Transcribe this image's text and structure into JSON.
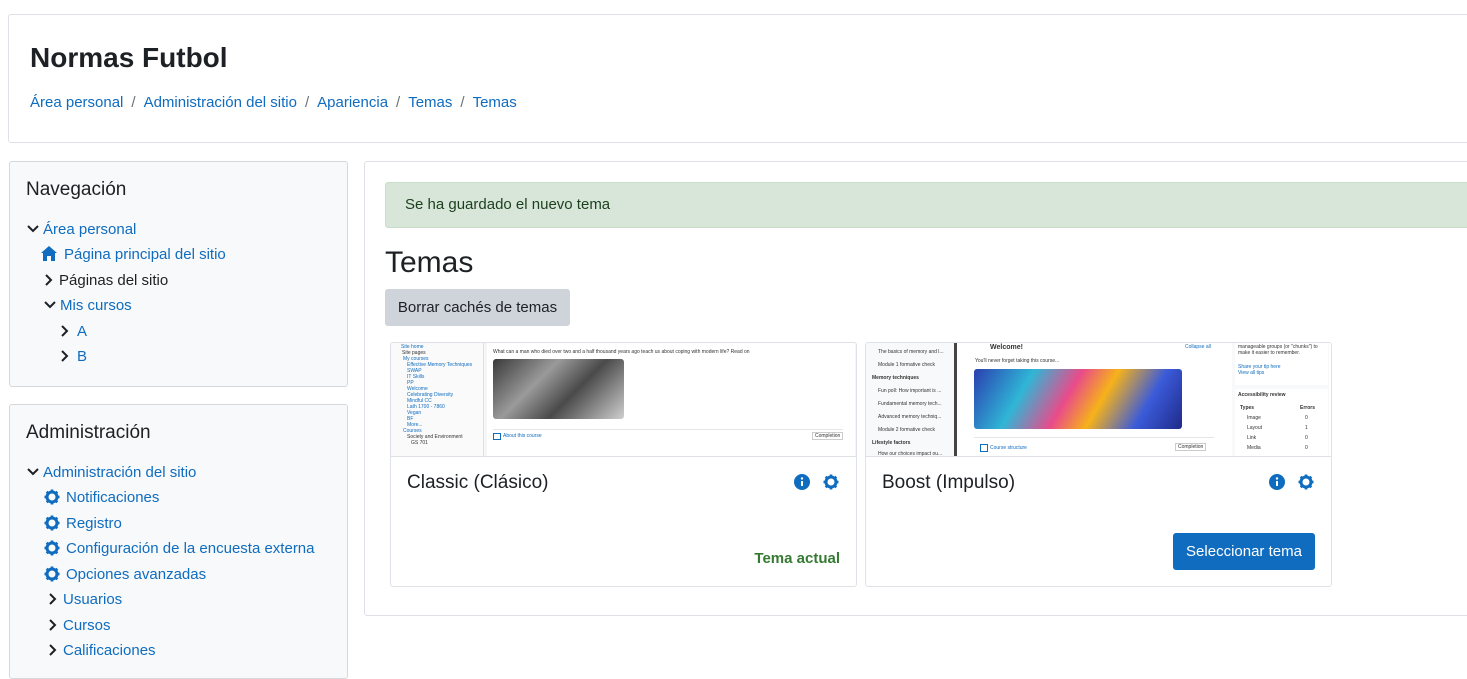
{
  "header": {
    "site_title": "Normas Futbol",
    "breadcrumb": [
      "Área personal",
      "Administración del sitio",
      "Apariencia",
      "Temas",
      "Temas"
    ],
    "separator": "/"
  },
  "nav_block": {
    "title": "Navegación",
    "items": [
      {
        "label": "Área personal",
        "icon": "chevron-down-icon"
      },
      {
        "label": "Página principal del sitio",
        "icon": "home-icon"
      },
      {
        "label": "Páginas del sitio",
        "icon": "chevron-right-icon"
      },
      {
        "label": "Mis cursos",
        "icon": "chevron-down-icon"
      },
      {
        "label": "A",
        "icon": "chevron-right-icon"
      },
      {
        "label": "B",
        "icon": "chevron-right-icon"
      }
    ]
  },
  "admin_block": {
    "title": "Administración",
    "items": [
      {
        "label": "Administración del sitio",
        "icon": "chevron-down-icon"
      },
      {
        "label": "Notificaciones",
        "icon": "gear-icon"
      },
      {
        "label": "Registro",
        "icon": "gear-icon"
      },
      {
        "label": "Configuración de la encuesta externa",
        "icon": "gear-icon"
      },
      {
        "label": "Opciones avanzadas",
        "icon": "gear-icon"
      },
      {
        "label": "Usuarios",
        "icon": "chevron-right-icon"
      },
      {
        "label": "Cursos",
        "icon": "chevron-right-icon"
      },
      {
        "label": "Calificaciones",
        "icon": "chevron-right-icon"
      }
    ]
  },
  "main": {
    "alert": "Se ha guardado el nuevo tema",
    "heading": "Temas",
    "purge_button": "Borrar cachés de temas",
    "themes": [
      {
        "name": "Classic (Clásico)",
        "status": "Tema actual",
        "preview": {
          "tree": [
            "Site home",
            "Site pages",
            "My courses",
            "Effective Memory Techniques",
            "SWAP",
            "IT Skills",
            "PP",
            "Welcome",
            "Celebrating Diversity",
            "Mindful CC",
            "Lath 1700 - 7860",
            "Vegan",
            "BF",
            "More...",
            "Courses",
            "Society and Environment",
            "GS 701"
          ],
          "intro": "What can a man who died over two and a half thousand years ago teach us about coping with modern life? Read on",
          "link": "About this course",
          "select": "Completion"
        }
      },
      {
        "name": "Boost (Impulso)",
        "select_button": "Seleccionar tema",
        "preview": {
          "left": [
            "The basics of memory and l...",
            "Module 1 formative check",
            "Memory techniques",
            "Fun poll: How important is ...",
            "Fundamental memory tech...",
            "Advanced memory techniq...",
            "Module 2 formative check",
            "Lifestyle factors",
            "How our choices impact ou..."
          ],
          "welcome": "Welcome!",
          "collapse": "Collapse all",
          "subtitle": "You'll never forget taking this course...",
          "link": "Course structure",
          "select": "Completion",
          "right_top": "manageable groups (or \"chunks\") to make it easier to remember.",
          "share": "Share your tip here",
          "view": "View all tips",
          "review_title": "Accessibility review",
          "review_headers": [
            "Types",
            "Errors"
          ],
          "review_rows": [
            [
              "Image",
              "0"
            ],
            [
              "Layout",
              "1"
            ],
            [
              "Link",
              "0"
            ],
            [
              "Media",
              "0"
            ]
          ]
        }
      }
    ]
  }
}
